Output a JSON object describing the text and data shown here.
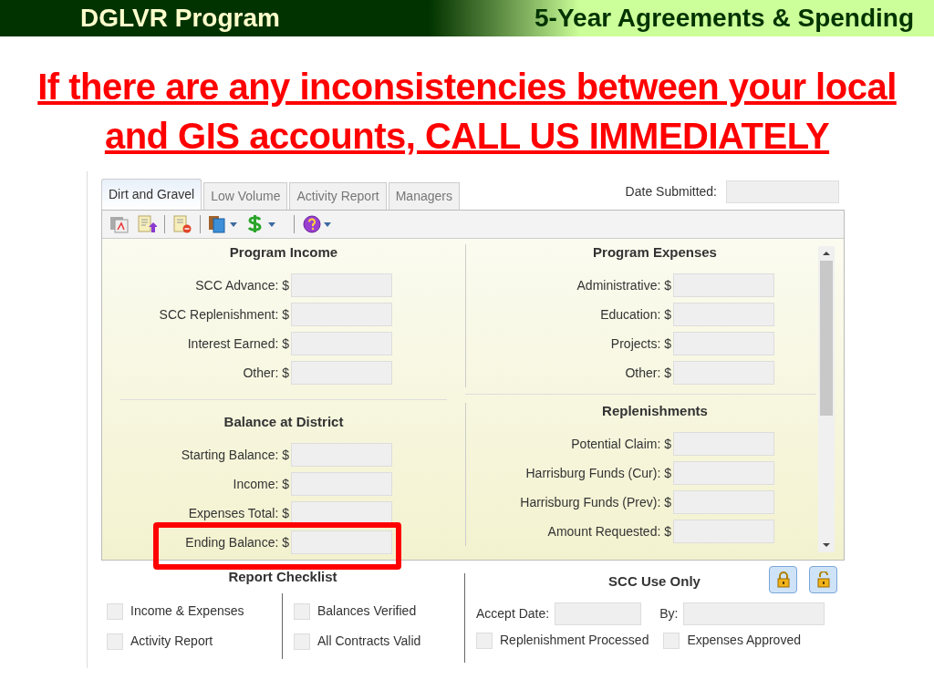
{
  "header": {
    "left_title": "DGLVR Program",
    "right_title": "5-Year Agreements & Spending"
  },
  "headline": {
    "lines": [
      "If there are any inconsistencies between your local",
      "and GIS accounts, CALL US IMMEDIATELY"
    ]
  },
  "tabs": [
    {
      "label": "Dirt and Gravel",
      "selected": true
    },
    {
      "label": "Low Volume",
      "selected": false
    },
    {
      "label": "Activity Report",
      "selected": false
    },
    {
      "label": "Managers",
      "selected": false
    }
  ],
  "date_submitted": {
    "label": "Date Submitted:"
  },
  "sections": [
    {
      "title": "Program Income",
      "rows": [
        {
          "label": "SCC Advance: $",
          "highlighted": false
        },
        {
          "label": "SCC Replenishment: $",
          "highlighted": false
        },
        {
          "label": "Interest Earned: $",
          "highlighted": false
        },
        {
          "label": "Other: $",
          "highlighted": false
        }
      ]
    },
    {
      "title": "Program Expenses",
      "rows": [
        {
          "label": "Administrative: $",
          "highlighted": false
        },
        {
          "label": "Education: $",
          "highlighted": false
        },
        {
          "label": "Projects: $",
          "highlighted": false
        },
        {
          "label": "Other: $",
          "highlighted": false
        }
      ]
    },
    {
      "title": "Balance at District",
      "rows": [
        {
          "label": "Starting Balance: $",
          "highlighted": false
        },
        {
          "label": "Income: $",
          "highlighted": false
        },
        {
          "label": "Expenses Total: $",
          "highlighted": false
        },
        {
          "label": "Ending Balance: $",
          "highlighted": true
        }
      ]
    },
    {
      "title": "Replenishments",
      "rows": [
        {
          "label": "Potential Claim: $",
          "highlighted": false
        },
        {
          "label": "Harrisburg Funds (Cur): $",
          "highlighted": false
        },
        {
          "label": "Harrisburg Funds (Prev): $",
          "highlighted": false
        },
        {
          "label": "Amount Requested: $",
          "highlighted": false
        }
      ]
    }
  ],
  "report_checklist": {
    "title": "Report Checklist",
    "items": [
      {
        "label": "Income & Expenses",
        "checked": false
      },
      {
        "label": "Activity Report",
        "checked": false
      },
      {
        "label": "Balances Verified",
        "checked": false
      },
      {
        "label": "All Contracts Valid",
        "checked": false
      }
    ]
  },
  "scc_use_only": {
    "title": "SCC Use Only",
    "accept_date_label": "Accept Date:",
    "by_label": "By:",
    "items": [
      {
        "label": "Replenishment Processed",
        "checked": false
      },
      {
        "label": "Expenses Approved",
        "checked": false
      }
    ]
  }
}
